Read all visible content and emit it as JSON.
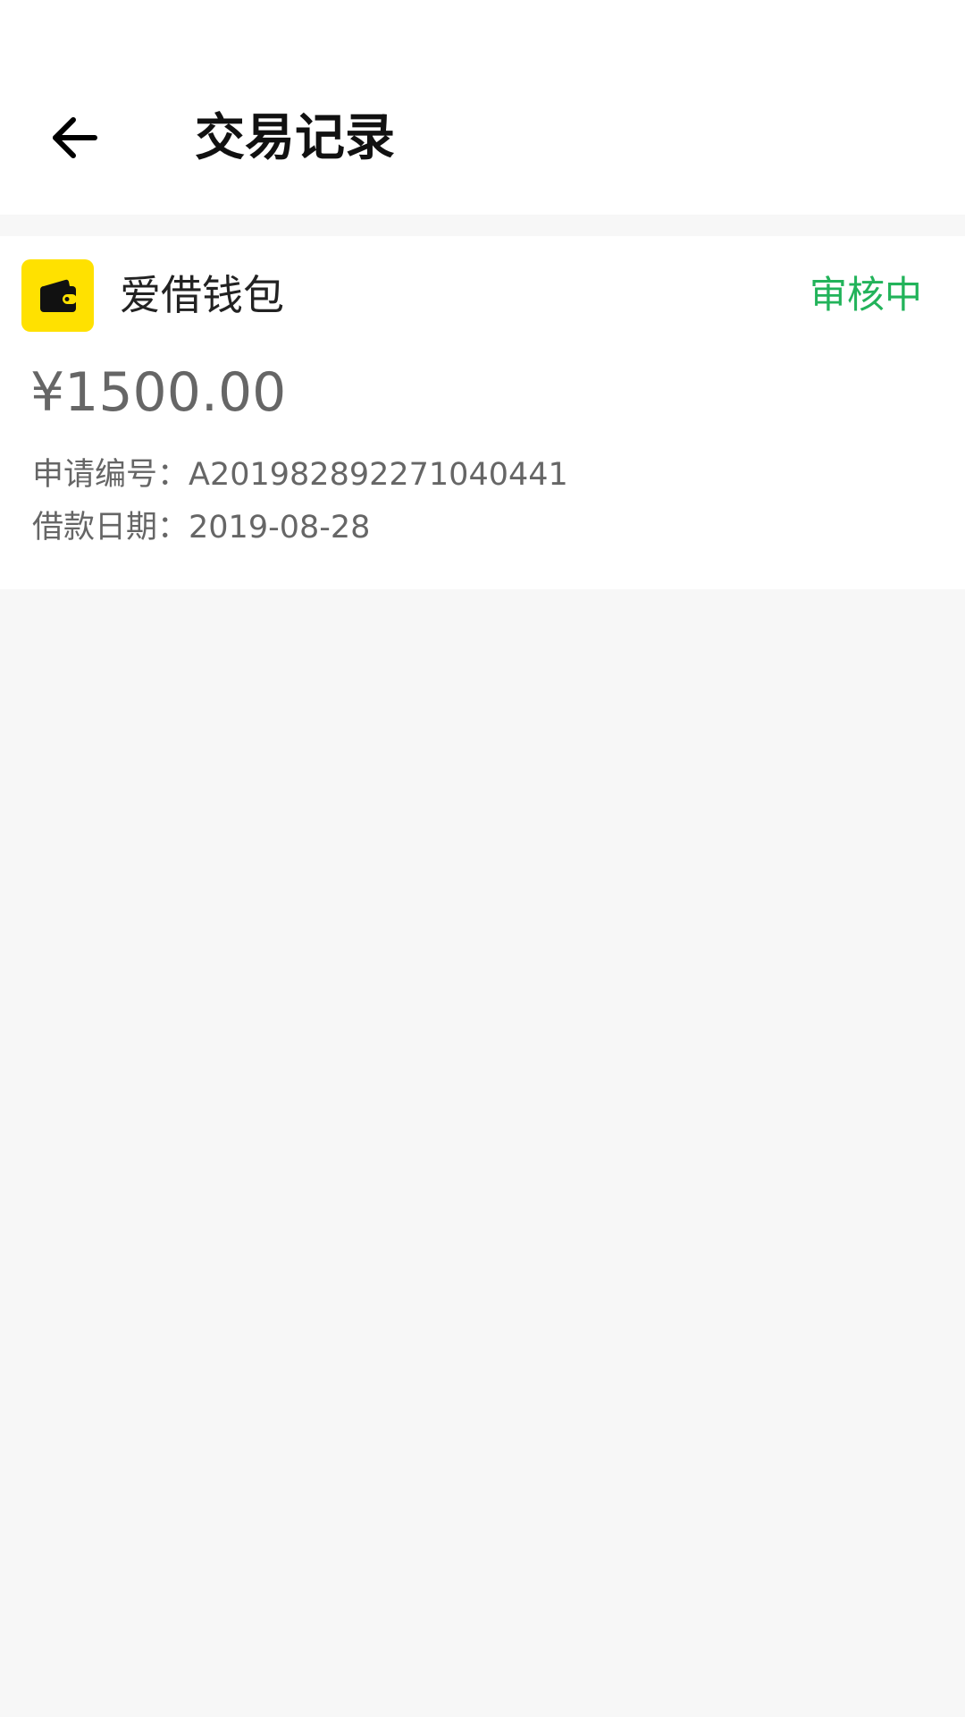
{
  "header": {
    "title": "交易记录"
  },
  "record": {
    "app_name": "爱借钱包",
    "status": "审核中",
    "amount": "¥1500.00",
    "application_label": "申请编号：",
    "application_id": "A201982892271040441",
    "date_label": "借款日期：",
    "loan_date": "2019-08-28"
  },
  "colors": {
    "status": "#22b35a",
    "logo_background": "#ffe100",
    "page_background": "#f7f7f7"
  },
  "icons": {
    "back": "arrow-left-icon",
    "app": "wallet-icon"
  }
}
